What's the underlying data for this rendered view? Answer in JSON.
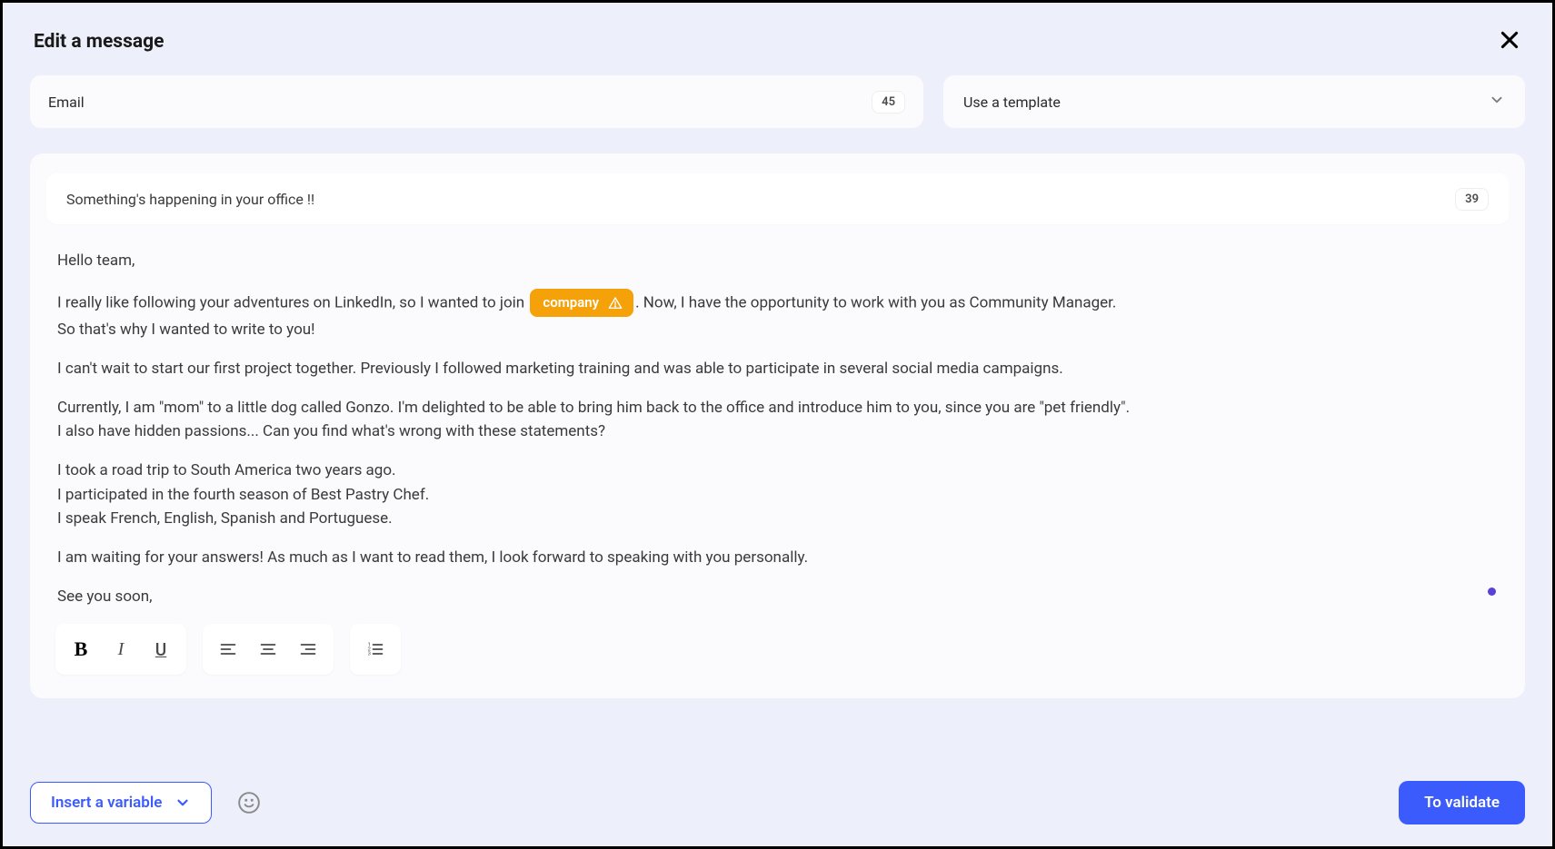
{
  "header": {
    "title": "Edit a message"
  },
  "top": {
    "email_label": "Email",
    "email_count": "45",
    "template_label": "Use a template"
  },
  "subject": {
    "text": "Something's happening in your office !!",
    "count": "39"
  },
  "body": {
    "p1": "Hello team,",
    "p2a": "I really like following your adventures on LinkedIn, so I wanted to join ",
    "var1": "company",
    "p2b": ". Now, I have the opportunity to work with you as Community Manager.",
    "p2c": "So that's why I wanted to write to you!",
    "p3": "I can't wait to start our first project together. Previously I followed marketing training and was able to participate in several social media campaigns.",
    "p4a": "Currently, I am \"mom\" to a little dog called Gonzo. I'm delighted to be able to bring him back to the office and introduce him to you, since you are \"pet friendly\".",
    "p4b": "I also have hidden passions... Can you find what's wrong with these statements?",
    "p5a": "I took a road trip to South America two years ago.",
    "p5b": "I participated in the fourth season of Best Pastry Chef.",
    "p5c": "I speak French, English, Spanish and Portuguese.",
    "p6": "I am waiting for your answers! As much as I want to read them, I look forward to speaking with you personally.",
    "p7": "See you soon,"
  },
  "toolbar": {
    "bold": "B",
    "italic": "I",
    "underline": "U"
  },
  "footer": {
    "insert_variable_label": "Insert a variable",
    "validate_label": "To validate"
  }
}
